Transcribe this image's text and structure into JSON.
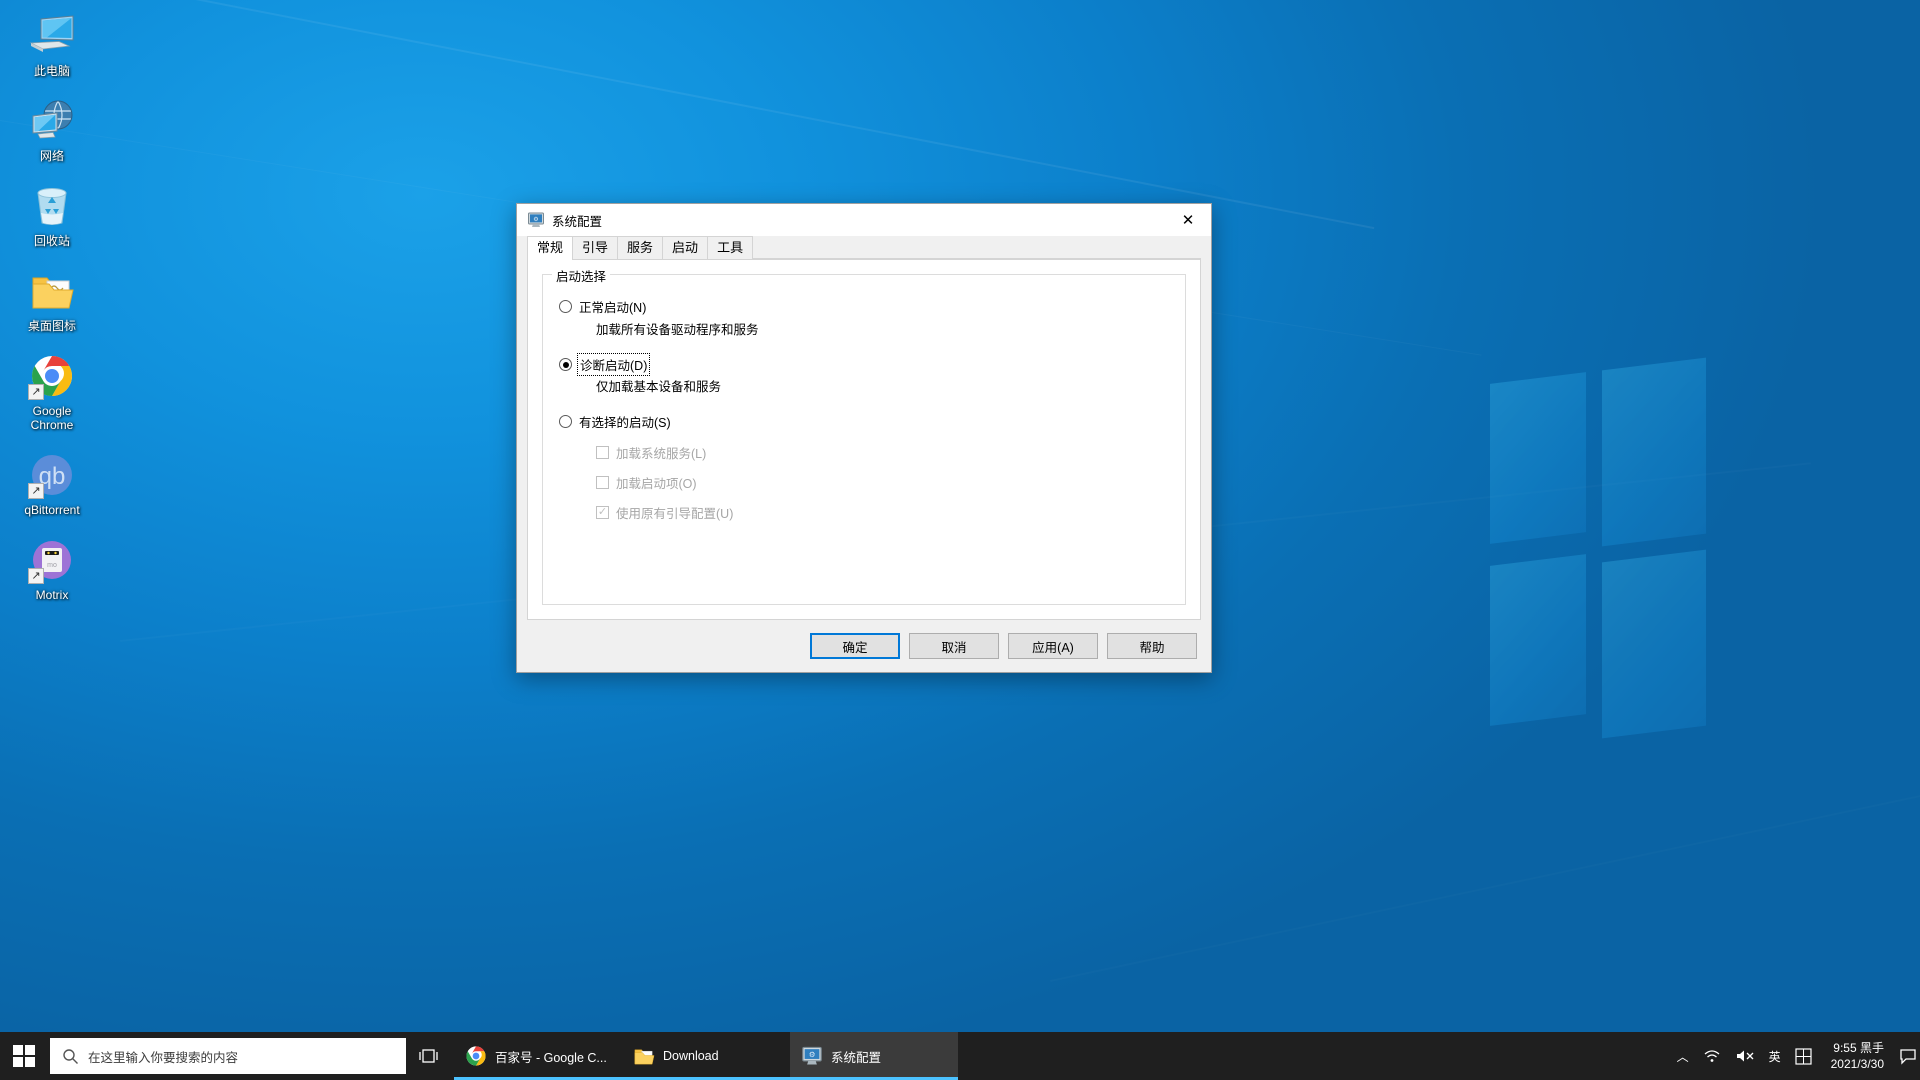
{
  "desktop": {
    "icons": [
      {
        "label": "此电脑",
        "icon": "this-pc-icon",
        "shortcut": false
      },
      {
        "label": "网络",
        "icon": "network-icon",
        "shortcut": false
      },
      {
        "label": "回收站",
        "icon": "recycle-bin-icon",
        "shortcut": false
      },
      {
        "label": "桌面图标",
        "icon": "folder-icon",
        "shortcut": false
      },
      {
        "label": "Google Chrome",
        "icon": "chrome-icon",
        "shortcut": true
      },
      {
        "label": "qBittorrent",
        "icon": "qbittorrent-icon",
        "shortcut": true
      },
      {
        "label": "Motrix",
        "icon": "motrix-icon",
        "shortcut": true
      }
    ]
  },
  "dialog": {
    "title": "系统配置",
    "title_icon": "system-config-icon",
    "close_label": "✕",
    "tabs": [
      {
        "label": "常规",
        "active": true
      },
      {
        "label": "引导",
        "active": false
      },
      {
        "label": "服务",
        "active": false
      },
      {
        "label": "启动",
        "active": false
      },
      {
        "label": "工具",
        "active": false
      }
    ],
    "group_title": "启动选择",
    "options": [
      {
        "label": "正常启动(N)",
        "selected": false,
        "focused": false,
        "description": "加载所有设备驱动程序和服务"
      },
      {
        "label": "诊断启动(D)",
        "selected": true,
        "focused": true,
        "description": "仅加载基本设备和服务"
      },
      {
        "label": "有选择的启动(S)",
        "selected": false,
        "focused": false,
        "description": ""
      }
    ],
    "checkboxes": [
      {
        "label": "加载系统服务(L)",
        "checked": false,
        "disabled": true
      },
      {
        "label": "加载启动项(O)",
        "checked": false,
        "disabled": true
      },
      {
        "label": "使用原有引导配置(U)",
        "checked": true,
        "disabled": true
      }
    ],
    "buttons": [
      {
        "label": "确定",
        "default": true
      },
      {
        "label": "取消",
        "default": false
      },
      {
        "label": "应用(A)",
        "default": false
      },
      {
        "label": "帮助",
        "default": false
      }
    ]
  },
  "taskbar": {
    "start_label": "start-button",
    "search_placeholder": "在这里输入你要搜索的内容",
    "task_view_label": "任务视图",
    "items": [
      {
        "label": "百家号 - Google C...",
        "icon": "chrome-icon",
        "active": false,
        "running": true
      },
      {
        "label": "Download",
        "icon": "folder-icon",
        "active": false,
        "running": true
      },
      {
        "label": "系统配置",
        "icon": "system-config-icon",
        "active": true,
        "running": true
      }
    ],
    "tray": {
      "chevron": "︿",
      "network_icon": "wifi-icon",
      "volume_icon": "volume-muted-icon",
      "ime_label": "英",
      "ime_mode_icon": "ime-icon",
      "time": "9:55",
      "owner": "黑手",
      "date": "2021/3/30",
      "notification_icon": "notification-icon"
    }
  }
}
